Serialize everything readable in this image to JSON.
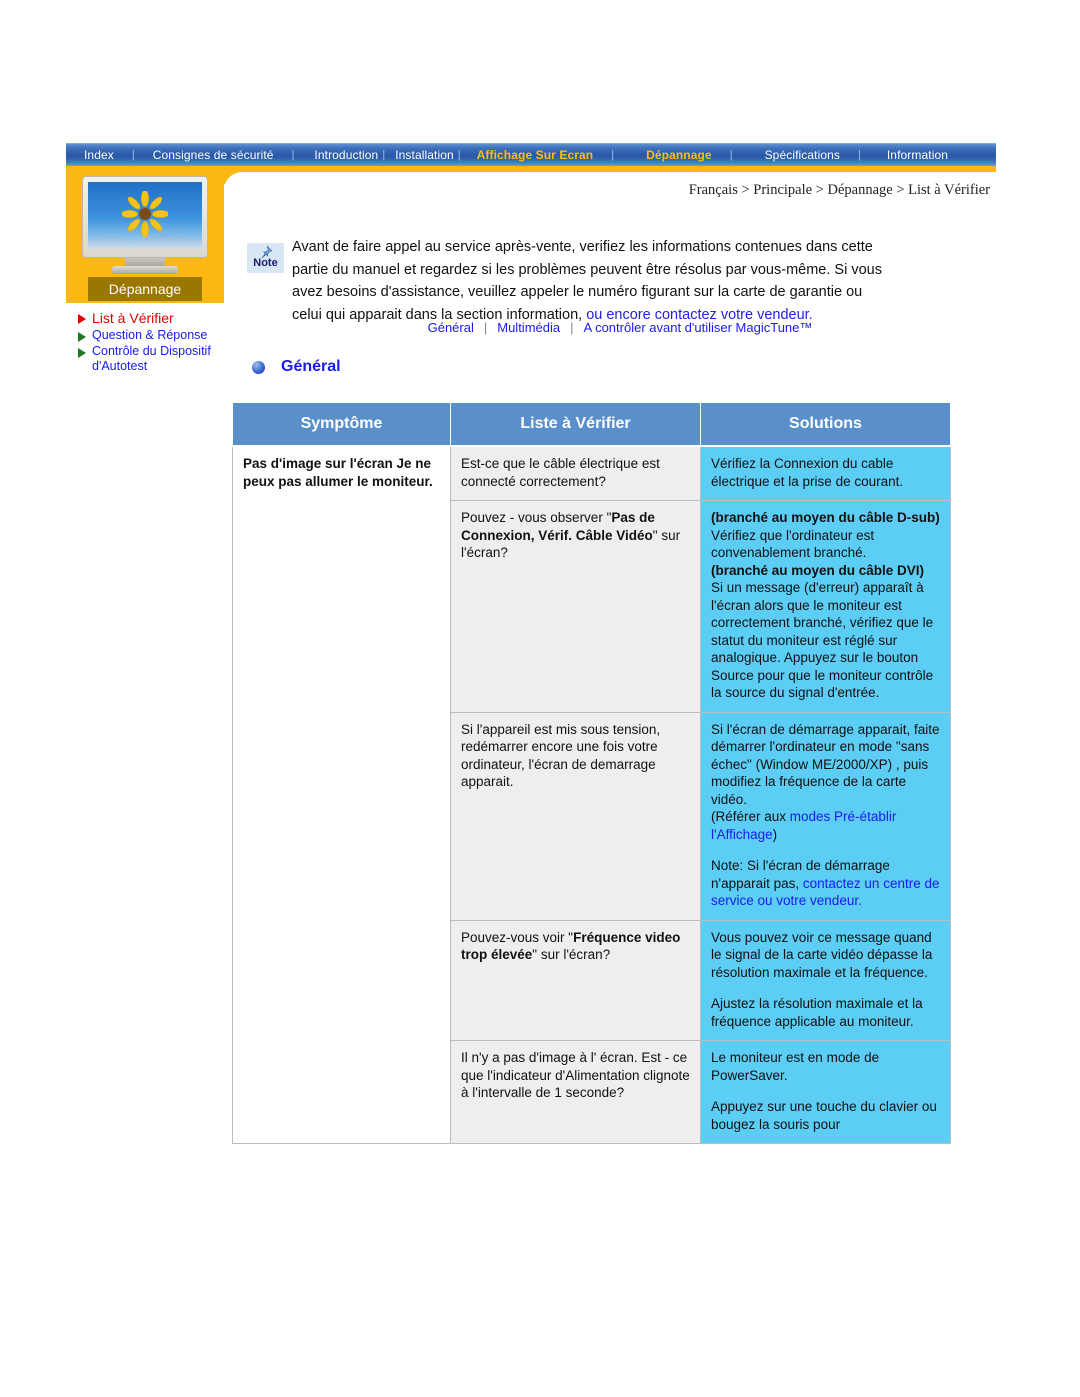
{
  "topnav": {
    "items": [
      {
        "label": "Index",
        "highlight": false
      },
      {
        "label": "Consignes de sécurité",
        "highlight": false
      },
      {
        "label": "Introduction",
        "highlight": false
      },
      {
        "label": "Installation",
        "highlight": false
      },
      {
        "label": "Affichage Sur Ecran",
        "highlight": true
      },
      {
        "label": "Dépannage",
        "highlight": true
      },
      {
        "label": "Spécifications",
        "highlight": false
      },
      {
        "label": "Information",
        "highlight": false
      }
    ],
    "separator": "|"
  },
  "sidebar": {
    "thumb_label": "Dépannage",
    "items": [
      {
        "label": "List à Vérifier",
        "active": true
      },
      {
        "label": "Question & Réponse",
        "active": false
      },
      {
        "label": "Contrôle du Dispositif d'Autotest",
        "active": false
      }
    ]
  },
  "breadcrumb": "Français > Principale > Dépannage > List à Vérifier",
  "note": {
    "icon_label": "Note",
    "line1": "Avant de faire appel au service après-vente, verifiez les informations contenues dans cette",
    "line2": "partie du manuel et regardez si les problèmes peuvent être résolus par vous-même. Si vous",
    "line3": "avez besoins d'assistance, veuillez appeler le numéro figurant sur la carte de garantie ou",
    "line4_plain": "celui qui apparait dans la section information, ",
    "line4_link": "ou encore contactez votre vendeur."
  },
  "subnav": {
    "items": [
      "Général",
      "Multimédia",
      "A contrôler avant d'utiliser MagicTune™"
    ],
    "separator": "|"
  },
  "section": {
    "title": "Général"
  },
  "table": {
    "headers": [
      "Symptôme",
      "Liste à Vérifier",
      "Solutions"
    ],
    "symptom": "Pas d'image sur l'écran Je ne peux pas allumer le moniteur.",
    "rows": [
      {
        "check_plain_1": "Est-ce que le câble électrique est connecté correctement?",
        "solution_1": "Vérifiez la Connexion du cable électrique et la prise de courant."
      },
      {
        "check_a": "Pouvez - vous observer \"",
        "check_b": "Pas de Connexion, Vérif. Câble Vidéo",
        "check_c": "\" sur l'écran?",
        "sol_h1": "(branché au moyen du câble D-sub)",
        "sol_t1": "Vérifiez que l'ordinateur est convenablement branché.",
        "sol_h2": "(branché au moyen du câble DVI)",
        "sol_t2": "Si un message (d'erreur) apparaît à l'écran alors que le moniteur est correctement branché, vérifiez que le statut du moniteur est réglé sur analogique. Appuyez sur le bouton Source pour que le moniteur contrôle la source du signal d'entrée."
      },
      {
        "check": "Si l'appareil est mis sous tension, redémarrer encore une fois votre ordinateur, l'écran de demarrage apparait.",
        "sol_p1": "Si l'écran de démarrage apparait, faite démarrer l'ordinateur en mode \"sans échec\" (Window ME/2000/XP) , puis modifiez la fréquence de la carte vidéo.",
        "sol_ref_open": "(Référer aux ",
        "sol_ref_link": "modes Pré-établir l'Affichage",
        "sol_ref_close": ")",
        "sol_note_plain": "Note: Si l'écran de démarrage n'apparait pas, ",
        "sol_note_link": "contactez un centre de service ou votre vendeur."
      },
      {
        "check_a": "Pouvez-vous voir \"",
        "check_b": "Fréquence video trop élevée",
        "check_c": "\" sur l'écran?",
        "sol_p1": "Vous pouvez voir ce message quand le signal de la carte vidéo dépasse la résolution maximale et la fréquence.",
        "sol_p2": "Ajustez la résolution maximale et la fréquence applicable au moniteur."
      },
      {
        "check": "Il n'y a pas d'image à l' écran. Est - ce que l'indicateur d'Alimentation clignote à l'intervalle de 1 seconde?",
        "sol_p1": "Le moniteur est en mode de PowerSaver.",
        "sol_p2": "Appuyez sur une touche du clavier ou bougez la souris pour"
      }
    ]
  },
  "colors": {
    "nav_blue": "#2b5aa8",
    "orange": "#fcb712",
    "header_blue": "#5b8fc9",
    "solution_cyan": "#5ccdf5",
    "check_gray": "#eeeeee",
    "link_blue": "#1a1aee",
    "active_red": "#e00000"
  }
}
